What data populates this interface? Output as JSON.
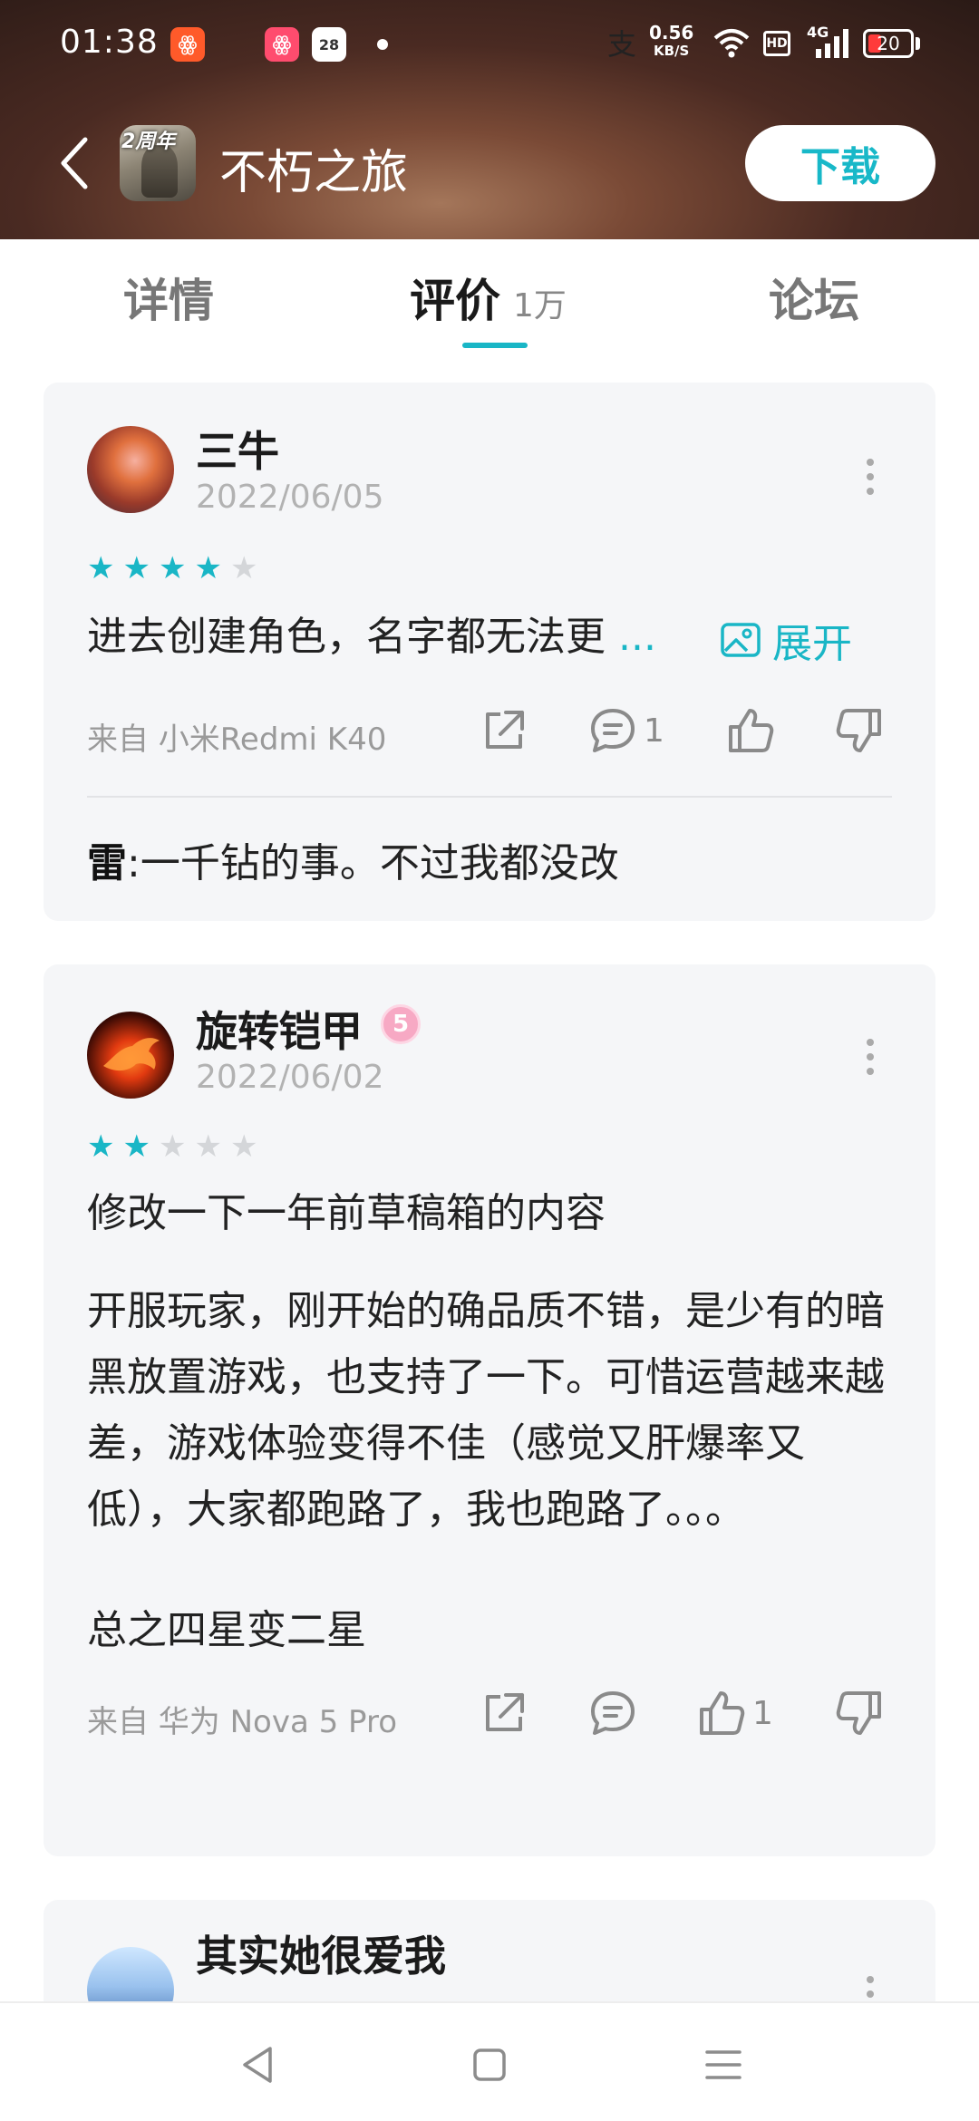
{
  "status_bar": {
    "time": "01:38",
    "net_speed_value": "0.56",
    "net_speed_unit": "KB/S",
    "battery": "20",
    "notifications": [
      "app-icon-orange",
      "alipay-icon",
      "app-icon-pink",
      "calendar-icon"
    ],
    "calendar_day": "28",
    "alipay_glyph": "支",
    "network": "4G",
    "hd_label": "HD"
  },
  "header": {
    "app_name": "不朽之旅",
    "icon_badge": "2周年",
    "download_label": "下载"
  },
  "tabs": [
    {
      "label": "详情"
    },
    {
      "label": "评价",
      "count": "1万"
    },
    {
      "label": "论坛"
    }
  ],
  "reviews": [
    {
      "user": "三牛",
      "date": "2022/06/05",
      "rating": 4,
      "text": "进去创建角色，名字都无法更",
      "ellipsis": "...",
      "expand_label": "展开",
      "source": "来自 小米Redmi K40",
      "comment_count": "1",
      "like_count": "",
      "reply": {
        "author": "雷",
        "text": ":一千钻的事。不过我都没改"
      }
    },
    {
      "user": "旋转铠甲",
      "level": "5",
      "date": "2022/06/02",
      "rating": 2,
      "title": "修改一下一年前草稿箱的内容",
      "body": "开服玩家，刚开始的确品质不错，是少有的暗黑放置游戏，也支持了一下。可惜运营越来越差，游戏体验变得不佳（感觉又肝爆率又低），大家都跑路了，我也跑路了。。。",
      "conclusion": "总之四星变二星",
      "source": "来自 华为 Nova 5 Pro",
      "comment_count": "",
      "like_count": "1"
    },
    {
      "user": "其实她很爱我"
    }
  ],
  "colors": {
    "accent": "#19b6c6",
    "card_bg": "#f5f6f8",
    "star_off": "#d4d6d9"
  }
}
